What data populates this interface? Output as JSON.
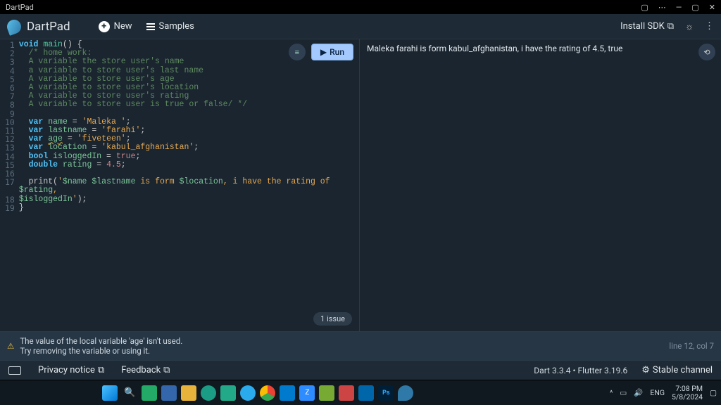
{
  "window": {
    "title": "DartPad"
  },
  "header": {
    "app_name": "DartPad",
    "new_label": "New",
    "samples_label": "Samples",
    "install_sdk": "Install SDK"
  },
  "editor": {
    "run_label": "Run",
    "issue_badge": "1 issue",
    "gutter_numbers": [
      "1",
      "2",
      "3",
      "4",
      "5",
      "6",
      "7",
      "8",
      "9",
      "10",
      "11",
      "12",
      "13",
      "14",
      "15",
      "16",
      "17",
      "",
      "18",
      "19"
    ],
    "code_lines": [
      [
        {
          "t": "void ",
          "c": "kw"
        },
        {
          "t": "main",
          "c": "fn"
        },
        {
          "t": "() {",
          "c": ""
        }
      ],
      [
        {
          "t": "  /* home work:",
          "c": "cm"
        }
      ],
      [
        {
          "t": "  A variable the store user's name",
          "c": "cm"
        }
      ],
      [
        {
          "t": "  a variable to store user's last name",
          "c": "cm"
        }
      ],
      [
        {
          "t": "  A variable to store user's age",
          "c": "cm"
        }
      ],
      [
        {
          "t": "  A variable to store user's location",
          "c": "cm"
        }
      ],
      [
        {
          "t": "  A variable to store user's rating",
          "c": "cm"
        }
      ],
      [
        {
          "t": "  A variable to store user is true or false/ */",
          "c": "cm"
        }
      ],
      [
        {
          "t": " ",
          "c": ""
        }
      ],
      [
        {
          "t": "  var ",
          "c": "kw"
        },
        {
          "t": "name",
          "c": "vr"
        },
        {
          "t": " = ",
          "c": ""
        },
        {
          "t": "'Maleka '",
          "c": "str"
        },
        {
          "t": ";",
          "c": ""
        }
      ],
      [
        {
          "t": "  var ",
          "c": "kw"
        },
        {
          "t": "lastname",
          "c": "vr"
        },
        {
          "t": " = ",
          "c": ""
        },
        {
          "t": "'farahi'",
          "c": "str"
        },
        {
          "t": ";",
          "c": ""
        }
      ],
      [
        {
          "t": "  var ",
          "c": "kw"
        },
        {
          "t": "age",
          "c": "vr underline"
        },
        {
          "t": " = ",
          "c": ""
        },
        {
          "t": "'fiveteen'",
          "c": "str"
        },
        {
          "t": ";",
          "c": ""
        }
      ],
      [
        {
          "t": "  var ",
          "c": "kw"
        },
        {
          "t": "location",
          "c": "vr"
        },
        {
          "t": " = ",
          "c": ""
        },
        {
          "t": "'kabul_afghanistan'",
          "c": "str"
        },
        {
          "t": ";",
          "c": ""
        }
      ],
      [
        {
          "t": "  bool ",
          "c": "kw"
        },
        {
          "t": "isloggedIn",
          "c": "vr"
        },
        {
          "t": " = ",
          "c": ""
        },
        {
          "t": "true",
          "c": "lit"
        },
        {
          "t": ";",
          "c": ""
        }
      ],
      [
        {
          "t": "  double ",
          "c": "kw"
        },
        {
          "t": "rating",
          "c": "vr"
        },
        {
          "t": " = ",
          "c": ""
        },
        {
          "t": "4.5",
          "c": "lit"
        },
        {
          "t": ";",
          "c": ""
        }
      ],
      [
        {
          "t": " ",
          "c": ""
        }
      ],
      [
        {
          "t": "  print(",
          "c": ""
        },
        {
          "t": "'",
          "c": "str"
        },
        {
          "t": "$name",
          "c": "vr"
        },
        {
          "t": " ",
          "c": "str"
        },
        {
          "t": "$lastname",
          "c": "vr"
        },
        {
          "t": " is form ",
          "c": "str"
        },
        {
          "t": "$location",
          "c": "vr"
        },
        {
          "t": ", i have the rating of ",
          "c": "str"
        },
        {
          "t": "$rating",
          "c": "vr"
        },
        {
          "t": ", ",
          "c": "str"
        }
      ],
      [
        {
          "t": "$isloggedIn",
          "c": "vr"
        },
        {
          "t": "'",
          "c": "str"
        },
        {
          "t": ");",
          "c": ""
        }
      ],
      [
        {
          "t": "}",
          "c": ""
        }
      ],
      [
        {
          "t": " ",
          "c": ""
        }
      ]
    ]
  },
  "output": {
    "text": "Maleka  farahi is form kabul_afghanistan, i have the rating of 4.5,  true"
  },
  "problems": {
    "message": "The value of the local variable 'age' isn't used.",
    "hint": "Try removing the variable or using it.",
    "location": "line 12, col 7"
  },
  "footer": {
    "privacy": "Privacy notice",
    "feedback": "Feedback",
    "version": "Dart 3.3.4 • Flutter 3.19.6",
    "channel": "Stable channel"
  },
  "taskbar": {
    "lang": "ENG",
    "time": "7:08 PM",
    "date": "5/8/2024"
  }
}
